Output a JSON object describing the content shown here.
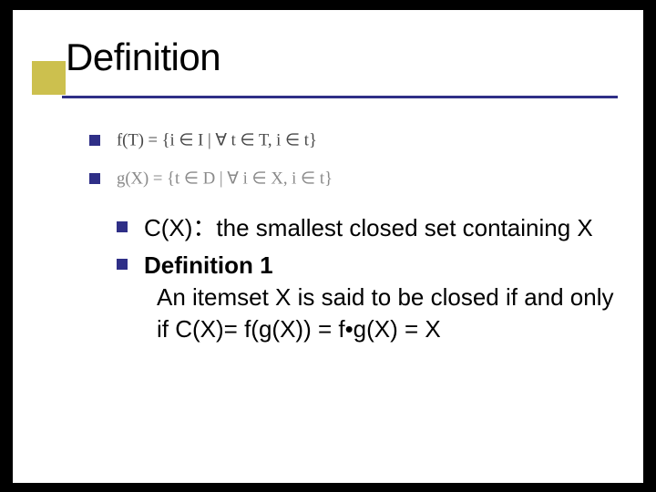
{
  "slide": {
    "title": "Definition",
    "formula1": "f(T) = { i ∈ I | ∀ t ∈ T, i ∈ t }",
    "formula2": "g(X) = { t ∈ D | ∀ i ∈ X, i ∈ t }",
    "bullet3": "C(X)：the smallest closed set containing X",
    "bullet4_label": "Definition 1",
    "bullet4_body": "An itemset X is said to be closed if and only if C(X)= f(g(X)) = f•g(X) = X"
  }
}
